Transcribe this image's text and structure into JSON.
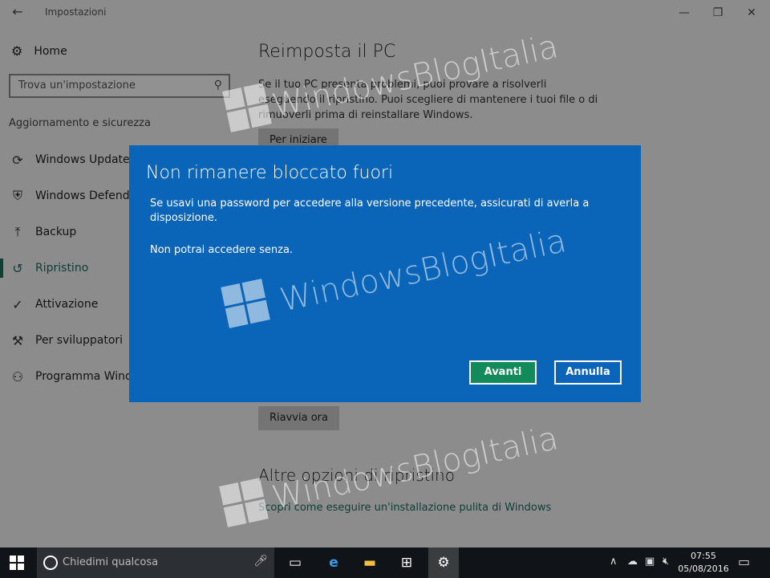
{
  "window": {
    "title": "Impostazioni",
    "back_icon": "arrow-left-icon",
    "controls": {
      "minimize": "—",
      "restore": "❐",
      "close": "✕"
    }
  },
  "sidebar": {
    "home_label": "Home",
    "search_placeholder": "Trova un'impostazione",
    "section_title": "Aggiornamento e sicurezza",
    "items": [
      {
        "label": "Windows Update",
        "icon": "refresh-icon",
        "glyph": "⟳"
      },
      {
        "label": "Windows Defender",
        "icon": "shield-icon",
        "glyph": "⛨"
      },
      {
        "label": "Backup",
        "icon": "upload-arrow-icon",
        "glyph": "⤒"
      },
      {
        "label": "Ripristino",
        "icon": "history-icon",
        "glyph": "↺"
      },
      {
        "label": "Attivazione",
        "icon": "check-circle-icon",
        "glyph": "✓"
      },
      {
        "label": "Per sviluppatori",
        "icon": "tools-icon",
        "glyph": "⚒"
      },
      {
        "label": "Programma Windows Insider",
        "icon": "person-gear-icon",
        "glyph": "⚇"
      }
    ]
  },
  "main": {
    "reset_title": "Reimposta il PC",
    "reset_description": "Se il tuo PC presenta problemi, puoi provare a risolverli eseguendo il ripristino. Puoi scegliere di mantenere i tuoi file o di rimuoverli prima di reinstallare Windows.",
    "start_button": "Per iniziare",
    "restart_button": "Riavvia ora",
    "more_options_title": "Altre opzioni di ripristino",
    "clean_install_link": "Scopri come eseguire un'installazione pulita di Windows"
  },
  "dialog": {
    "title": "Non rimanere bloccato fuori",
    "message": "Se usavi una password per accedere alla versione precedente, assicurati di averla a disposizione.",
    "warning": "Non potrai accedere senza.",
    "next_button": "Avanti",
    "cancel_button": "Annulla"
  },
  "watermark_text": "WindowsBlogItalia",
  "taskbar": {
    "search_placeholder": "Chiedimi qualcosa",
    "time": "07:55",
    "date": "05/08/2016"
  }
}
